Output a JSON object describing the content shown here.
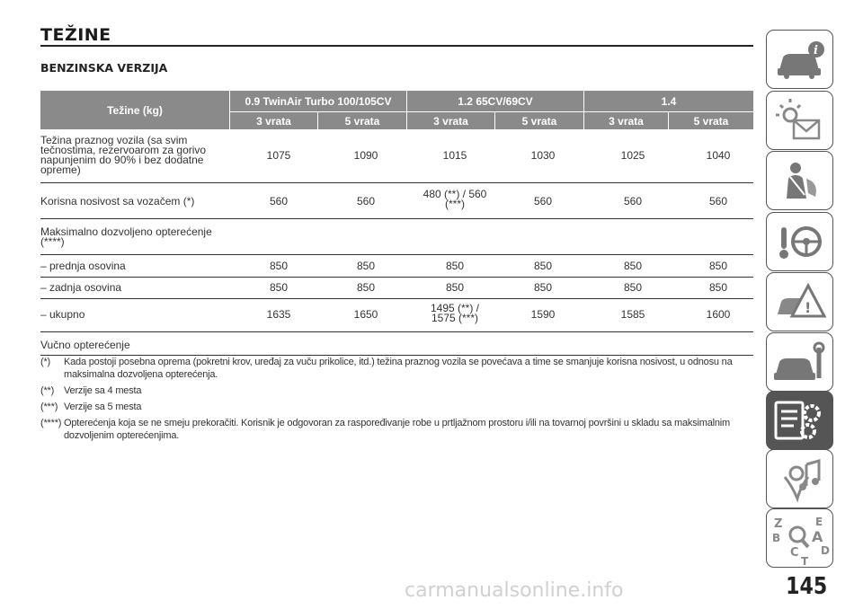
{
  "heading": "TEŽINE",
  "section": "BENZINSKA VERZIJA",
  "table": {
    "corner": "Težine (kg)",
    "groups": [
      "0.9 TwinAir Turbo 100/105CV",
      "1.2 65CV/69CV",
      "1.4"
    ],
    "subs": [
      "3 vrata",
      "5 vrata",
      "3 vrata",
      "5 vrata",
      "3 vrata",
      "5 vrata"
    ],
    "rows": [
      {
        "label": "Težina praznog vozila (sa svim tečnostima, rezervoarom za gorivo napunjenim do 90% i bez dodatne opreme)",
        "values": [
          "1075",
          "1090",
          "1015",
          "1030",
          "1025",
          "1040"
        ]
      },
      {
        "label": "Korisna nosivost sa vozačem (*)",
        "values": [
          "560",
          "560",
          "480 (**) / 560 (***)",
          "560",
          "560",
          "560"
        ]
      },
      {
        "label": "Maksimalno dozvoljeno opterećenje (****)",
        "values": [
          "",
          "",
          "",
          "",
          "",
          ""
        ]
      },
      {
        "label": "– prednja osovina",
        "values": [
          "850",
          "850",
          "850",
          "850",
          "850",
          "850"
        ]
      },
      {
        "label": "– zadnja osovina",
        "values": [
          "850",
          "850",
          "850",
          "850",
          "850",
          "850"
        ]
      },
      {
        "label": "– ukupno",
        "values": [
          "1635",
          "1650",
          "1495 (**) / 1575 (***)",
          "1590",
          "1585",
          "1600"
        ]
      },
      {
        "label": "Vučno opterećenje",
        "values": [
          "",
          "",
          "",
          "",
          "",
          ""
        ]
      }
    ]
  },
  "notes": [
    {
      "key": "(*)",
      "text": "Kada postoji posebna oprema (pokretni krov, uređaj za vuču prikolice, itd.) težina praznog vozila se povećava a time se smanjuje korisna nosivost, u odnosu na maksimalna dozvoljena opterećenja."
    },
    {
      "key": "(**)",
      "text": "Verzije sa 4 mesta"
    },
    {
      "key": "(***)",
      "text": "Verzije sa 5 mesta"
    },
    {
      "key": "(****)",
      "text": "Opterećenja koja se ne smeju prekoračiti. Korisnik je odgovoran za raspoređivanje robe u prtljažnom prostoru i/ili na tovarnoj površini u skladu sa maksimalnim dozvoljenim opterećenjima."
    }
  ],
  "sidebar": {
    "tabs": [
      {
        "icon": "car-info-icon"
      },
      {
        "icon": "warning-lights-icon"
      },
      {
        "icon": "safety-seatbelt-icon"
      },
      {
        "icon": "starting-driving-icon"
      },
      {
        "icon": "emergency-icon"
      },
      {
        "icon": "maintenance-icon"
      },
      {
        "icon": "technical-data-icon",
        "active": true
      },
      {
        "icon": "multimedia-icon"
      },
      {
        "icon": "index-icon"
      }
    ],
    "index_letters": [
      "Z",
      "E",
      "B",
      "A",
      "C",
      "D",
      "T"
    ]
  },
  "page_number": "145",
  "watermark": "carmanualsonline.info"
}
